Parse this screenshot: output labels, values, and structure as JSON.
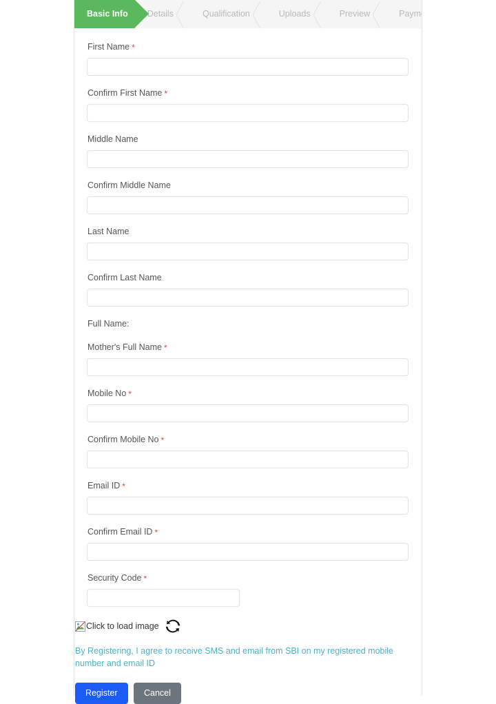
{
  "wizard": {
    "steps": [
      {
        "label": "Basic Info",
        "active": true
      },
      {
        "label": "Details",
        "active": false
      },
      {
        "label": "Qualification",
        "active": false
      },
      {
        "label": "Uploads",
        "active": false
      },
      {
        "label": "Preview",
        "active": false
      },
      {
        "label": "Payment",
        "active": false
      }
    ],
    "active_color": "#5cb85c",
    "bar_background": "#f5f5f5",
    "inactive_text_color": "#b8b8b8"
  },
  "form": {
    "fields": [
      {
        "label": "First Name",
        "required": true,
        "value": "",
        "placeholder": "",
        "type": "input",
        "width": "full"
      },
      {
        "label": "Confirm First Name",
        "required": true,
        "value": "",
        "placeholder": "",
        "type": "input",
        "width": "full"
      },
      {
        "label": "Middle Name",
        "required": false,
        "value": "",
        "placeholder": "",
        "type": "input",
        "width": "full"
      },
      {
        "label": "Confirm Middle Name",
        "required": false,
        "value": "",
        "placeholder": "",
        "type": "input",
        "width": "full"
      },
      {
        "label": "Last Name",
        "required": false,
        "value": "",
        "placeholder": "",
        "type": "input",
        "width": "full"
      },
      {
        "label": "Confirm Last Name",
        "required": false,
        "value": "",
        "placeholder": "",
        "type": "input",
        "width": "full"
      },
      {
        "label": "Full Name:",
        "required": false,
        "value": "",
        "placeholder": "",
        "type": "static",
        "width": "none"
      },
      {
        "label": "Mother's Full Name",
        "required": true,
        "value": "",
        "placeholder": "",
        "type": "input",
        "width": "full"
      },
      {
        "label": "Mobile No",
        "required": true,
        "value": "",
        "placeholder": "",
        "type": "input",
        "width": "full"
      },
      {
        "label": "Confirm Mobile No",
        "required": true,
        "value": "",
        "placeholder": "",
        "type": "input",
        "width": "full"
      },
      {
        "label": "Email ID",
        "required": true,
        "value": "",
        "placeholder": "",
        "type": "input",
        "width": "full"
      },
      {
        "label": "Confirm Email ID",
        "required": true,
        "value": "",
        "placeholder": "",
        "type": "input",
        "width": "full"
      },
      {
        "label": "Security Code",
        "required": true,
        "value": "",
        "placeholder": "",
        "type": "input",
        "width": "narrow"
      }
    ],
    "required_marker": "*"
  },
  "captcha": {
    "image_alt": "Click to load image",
    "refresh_icon": "refresh-icon"
  },
  "agreement": {
    "text": "By Registering, I agree to receive SMS and email from SBI on my registered mobile number and email ID",
    "color": "#4ab3c4"
  },
  "buttons": {
    "submit_label": "Register",
    "cancel_label": "Cancel",
    "submit_color": "#1a5cf5",
    "cancel_color": "#6c757d"
  }
}
